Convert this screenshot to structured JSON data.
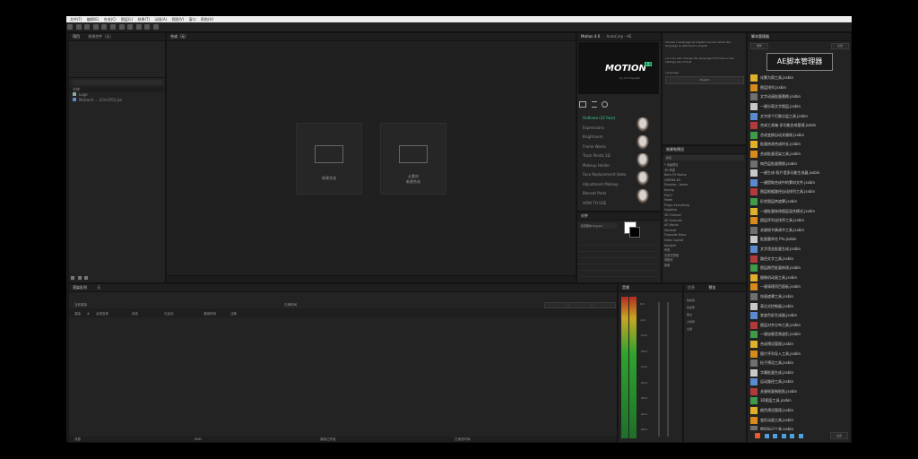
{
  "menubar": {
    "items": [
      "文件(F)",
      "编辑(E)",
      "合成(C)",
      "图层(L)",
      "效果(T)",
      "动画(A)",
      "视图(V)",
      "窗口",
      "帮助(H)"
    ]
  },
  "project_panel": {
    "tabs": [
      "项目",
      "效果控件（无）"
    ],
    "header_name": "名称",
    "files": [
      "Logo",
      "Motion4 ... 4.0v3701.jsx"
    ]
  },
  "comp_panel": {
    "tab": "合成（无）",
    "new_comp_label": "新建合成",
    "footage_label_line1": "从素材",
    "footage_label_line2": "新建合成"
  },
  "motion_panel": {
    "tabs": [
      "Motion 4.0",
      "AutoCrop - AE"
    ],
    "logo_text": "MOTION",
    "logo_badge": "4.0",
    "logo_sub": "by mt.mograph",
    "categories": [
      "Outlinea (32 face)",
      "Expressions",
      "Brightroom",
      "Frame Works",
      "Track Points 3D",
      "Makeup Holder",
      "Face Replacement (beta)",
      "Adjustment Makeup",
      "Blenset Parts",
      "HOW TO USE"
    ],
    "help_text_1": "Choose a language as english one and when the language is switched to english",
    "help_text_2": "you can also change the language from here in the settings tab of Duik",
    "select_label": "Language",
    "select_value": "English"
  },
  "effects_panel": {
    "tab": "效果和预设",
    "search_placeholder": "搜索",
    "items": [
      "* 动画预设",
      "3D 声道",
      "Boris FX Mocha",
      "CINEMA 4D",
      "Dissolve - Vector",
      "Keying",
      "Plot 5",
      "Matte",
      "Plugin Everything",
      "Sapphire",
      "3D Channel",
      "AE Channels",
      "AE Mocha",
      "Stardust",
      "Trapcode Shine",
      "Video Copilot",
      "Keylight",
      "声音",
      "沉浸式视频",
      "风格化",
      "抠像"
    ]
  },
  "align_panel": {
    "tab": "对齐",
    "font_name": "思源黑体 Regular"
  },
  "timeline_panel": {
    "tabs": [
      "渲染队列",
      "无"
    ],
    "current_render": "当前渲染",
    "elapsed": "已用时间",
    "columns": [
      "渲染",
      "#",
      "合成名称",
      "状态",
      "已启动",
      "渲染时间",
      "注释"
    ],
    "footer_msg": "消息",
    "footer_ram": "RAM",
    "footer_render_start": "渲染已开始",
    "footer_total": "已用总时间"
  },
  "audio_panel": {
    "tab": "音频",
    "db_labels": [
      "0.0",
      "-6.0",
      "-12.0",
      "-18.0",
      "-24.0",
      "-30.0",
      "-36.0",
      "-42.0",
      "-48.0"
    ]
  },
  "preview_panel": {
    "tabs": [
      "信息",
      "预览"
    ],
    "labels": [
      "快捷键",
      "帧速率",
      "跳过",
      "分辨率",
      "全屏"
    ]
  },
  "script_manager": {
    "tab": "脚本管理器",
    "top_button": "刷新",
    "close_label": "关闭",
    "banner": "AE脚本管理器",
    "bottom_button": "设置",
    "scripts": [
      "化繁为简工具.jsxbin",
      "图层排列.jsxbin",
      "文字动画批量替换.jsxbin",
      "一键分离文字图层.jsxbin",
      "文字逐个打散分层工具.jsxbin",
      "合成工具箱-多功能合成管理.jsxbin",
      "合成变换自动关键帧.jsxbin",
      "批量修改合成时长.jsxbin",
      "合成批量渲染工具.jsxbin",
      "纯色层批量替换.jsxbin",
      "一键生成-照片墙多功能生成器.jsxbin",
      "一键提取合成中的素材文件.jsxbin",
      "图层根据路径自动排列工具.jsxbin",
      "形状图层转遮罩.jsxbin",
      "一键批量修改图层混合模式.jsxbin",
      "图层序列化排序工具.jsxbin",
      "关键帧节奏调节工具.jsxbin",
      "批量重命名 Pro.jsxbin",
      "文字烫金批量生成.jsxbin",
      "路径文字工具.jsxbin",
      "图层颜色批量修改.jsxbin",
      "摄像机动画工具.jsxbin",
      "一键清理项目面板.jsxbin",
      "快速遮罩工具.jsxbin",
      "表达式控制器.jsxbin",
      "渐变色彩生成器.jsxbin",
      "图层对齐分布工具.jsxbin",
      "一键加载音频波形.jsxbin",
      "合成预设管理.jsxbin",
      "图片序列导入工具.jsxbin",
      "粒子预设工具.jsxbin",
      "字幕批量生成.jsxbin",
      "运动路径工具.jsxbin",
      "关键帧复制粘贴.jsxbin",
      "3D图层工具.jsxbin",
      "颜色预设管理.jsxbin",
      "变形动画工具.jsxbin",
      "图层标记工具.jsxbin",
      "蒙版羽化工具.jsxbin",
      "图层父子链接工具.jsxbin"
    ]
  },
  "colors": {
    "bg": "#000000",
    "app": "#1b1b1b",
    "panel": "#232323",
    "accent": "#2a7fd4",
    "motion_green": "#3ecf8e",
    "meter_green": "#2fa32f"
  }
}
